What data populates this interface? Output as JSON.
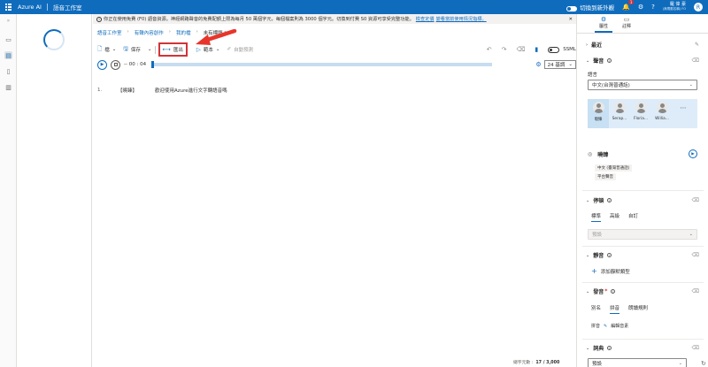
{
  "app": {
    "brand": "Azure AI",
    "title": "語音工作室",
    "switch_label": "切換到新外觀",
    "notification_count": "1",
    "user_name": "羅 偉 豪",
    "user_sub": "(無電郵名稱) FO",
    "avatar_letter": "R"
  },
  "notice": {
    "text": "你正在使用免費 (F0) 語音資源。神經網路聲音的免費配額上限為每月 50 萬個字元，每個檔案則為 3000 個字元。切換到付費 S0 資源可享受完整功能。",
    "link1": "檢查定價",
    "link2": "變看當前使用情況指標。"
  },
  "breadcrumb": {
    "items": [
      "語音工作室",
      "有聲內容創作",
      "我的檔"
    ],
    "current": "未有標題 *"
  },
  "toolbar": {
    "file": "檔",
    "save": "保存",
    "export": "匯出",
    "play": "範本",
    "auto_predict": "自動預測",
    "ssml": "SSML"
  },
  "player": {
    "time": "00 : 04",
    "bases_label": "24 基調"
  },
  "editor": {
    "lines": [
      {
        "num": "1.",
        "speaker": "【曉臻】",
        "text": "歡迎使用Azure進行文字轉語音嗎"
      }
    ]
  },
  "status": {
    "char_label": "總字元數 :",
    "char_count": "17 / 3,000"
  },
  "right": {
    "tabs": [
      "屬性",
      "註釋"
    ],
    "recent": "最近",
    "voice_section": "聲音",
    "language_label": "語言",
    "language_value": "中文(台灣普通話)",
    "voices": [
      "曉臻",
      "Serap...",
      "Floria...",
      "Willia..."
    ],
    "more": "⋯",
    "selected_voice": "曉臻",
    "voice_tags": [
      "中文 (臺灣普通話)",
      "平台聲音"
    ],
    "pause_section": "停頓",
    "pause_tabs": [
      "標準",
      "高級",
      "自訂"
    ],
    "pause_default": "預設",
    "silence_section": "靜音",
    "silence_add": "添加靜默類型",
    "pron_section": "發音",
    "pron_tabs": [
      "別名",
      "拼音",
      "朗讀規則"
    ],
    "pinyin_label": "拼音",
    "pinyin_edit": "編輯音素",
    "dict_section": "詞典",
    "dict_default": "預設"
  }
}
